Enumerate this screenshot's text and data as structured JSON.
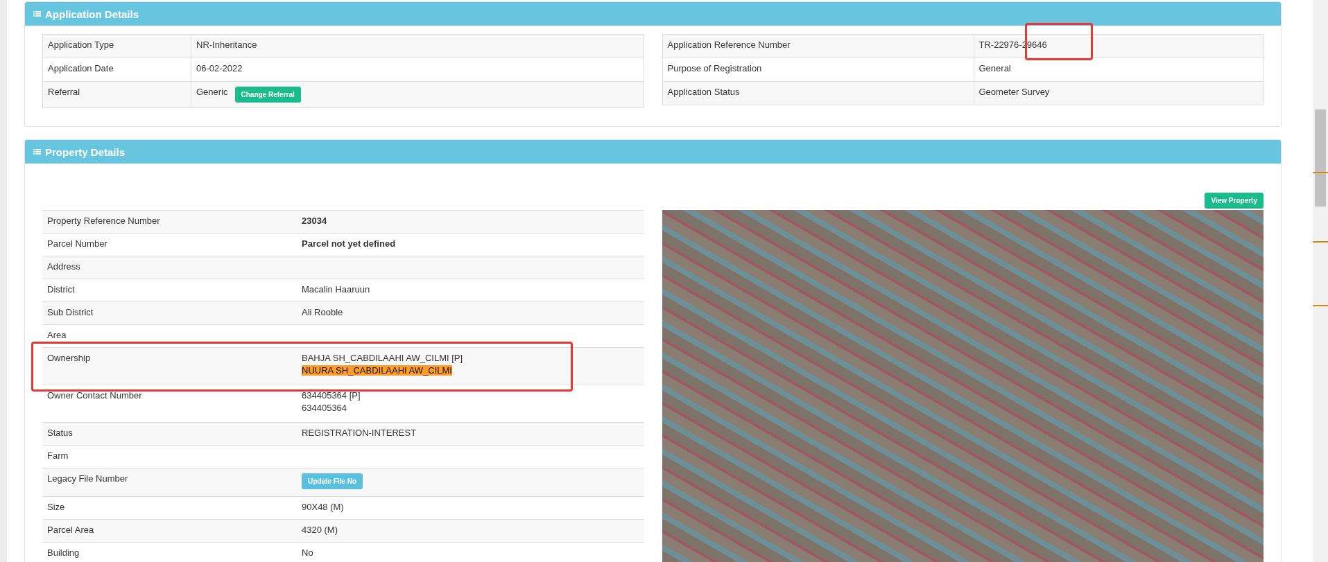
{
  "application_details": {
    "title": "Application Details",
    "left_rows": [
      {
        "label": "Application Type",
        "value": "NR-Inheritance"
      },
      {
        "label": "Application Date",
        "value": "06-02-2022"
      },
      {
        "label": "Referral",
        "value": "Generic",
        "button": "Change Referral"
      }
    ],
    "right_rows": [
      {
        "label": "Application Reference Number",
        "value": "TR-22976-29646"
      },
      {
        "label": "Purpose of Registration",
        "value": "General"
      },
      {
        "label": "Application Status",
        "value": "Geometer Survey"
      }
    ]
  },
  "property_details": {
    "title": "Property Details",
    "view_button": "View Property",
    "rows": [
      {
        "kind": "bold",
        "label": "Property Reference Number",
        "value": "23034"
      },
      {
        "kind": "bold",
        "label": "Parcel Number",
        "value": "Parcel not yet defined"
      },
      {
        "kind": "text",
        "label": "Address"
      },
      {
        "kind": "text",
        "label": "District",
        "value": "Macalin Haaruun"
      },
      {
        "kind": "text",
        "label": "Sub District",
        "value": "Ali Rooble"
      },
      {
        "kind": "text",
        "label": "Area"
      },
      {
        "kind": "lines",
        "label": "Ownership",
        "lines": [
          {
            "text": "BAHJA SH_CABDILAAHI AW_CILMI [P]",
            "highlighted": false
          },
          {
            "text": "NUURA SH_CABDILAAHI AW_CILMI",
            "highlighted": true
          }
        ]
      },
      {
        "kind": "lines",
        "label": "Owner Contact Number",
        "lines": [
          {
            "text": "634405364 [P]",
            "highlighted": false
          },
          {
            "text": "634405364",
            "highlighted": false
          }
        ]
      },
      {
        "kind": "text",
        "label": "Status",
        "value": "REGISTRATION-INTEREST"
      },
      {
        "kind": "text",
        "label": "Farm"
      },
      {
        "kind": "button",
        "label": "Legacy File Number",
        "button": "Update File No"
      },
      {
        "kind": "text",
        "label": "Size",
        "value": "90X48 (M)"
      },
      {
        "kind": "text",
        "label": "Parcel Area",
        "value": "4320 (M)"
      },
      {
        "kind": "text",
        "label": "Building",
        "value": "No"
      }
    ]
  }
}
